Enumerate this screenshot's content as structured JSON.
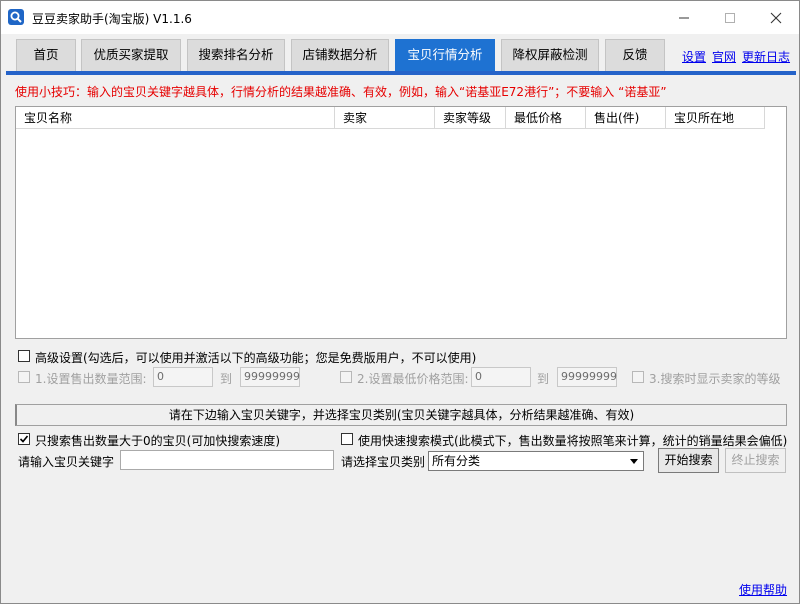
{
  "window": {
    "title": "豆豆卖家助手(淘宝版) V1.1.6"
  },
  "tabs": [
    {
      "label": "首页"
    },
    {
      "label": "优质买家提取"
    },
    {
      "label": "搜索排名分析"
    },
    {
      "label": "店铺数据分析"
    },
    {
      "label": "宝贝行情分析",
      "active": true
    },
    {
      "label": "降权屏蔽检测"
    },
    {
      "label": "反馈"
    }
  ],
  "links": {
    "settings": "设置",
    "official": "官网",
    "changelog": "更新日志",
    "help": "使用帮助"
  },
  "tip": "使用小技巧：输入的宝贝关键字越具体，行情分析的结果越准确、有效，例如，输入“诺基亚E72港行”；不要输入 “诺基亚”",
  "table": {
    "columns": [
      "宝贝名称",
      "卖家",
      "卖家等级",
      "最低价格",
      "售出(件)",
      "宝贝所在地"
    ],
    "rows": []
  },
  "advanced": {
    "label": "高级设置(勾选后，可以使用并激活以下的高级功能；您是免费版用户，不可以使用)",
    "checked": false,
    "sales_range": {
      "label": "1.设置售出数量范围:",
      "from": "0",
      "to_label": "到",
      "to": "99999999"
    },
    "price_range": {
      "label": "2.设置最低价格范围:",
      "from": "0",
      "to_label": "到",
      "to": "99999999"
    },
    "show_seller_level": {
      "label": "3.搜索时显示卖家的等级"
    }
  },
  "search": {
    "banner": "请在下边输入宝贝关键字，并选择宝贝类别(宝贝关键字越具体，分析结果越准确、有效)",
    "only_sold_label": "只搜索售出数量大于0的宝贝(可加快搜索速度)",
    "only_sold_checked": true,
    "fast_mode_label": "使用快速搜索模式(此模式下，售出数量将按照笔来计算，统计的销量结果会偏低)",
    "fast_mode_checked": false,
    "keyword_label": "请输入宝贝关键字",
    "keyword_value": "",
    "category_label": "请选择宝贝类别",
    "category_value": "所有分类",
    "start_button": "开始搜索",
    "stop_button": "终止搜索"
  },
  "colors": {
    "accent": "#1e72d2",
    "tip": "#e60000",
    "link": "#0000ee"
  }
}
